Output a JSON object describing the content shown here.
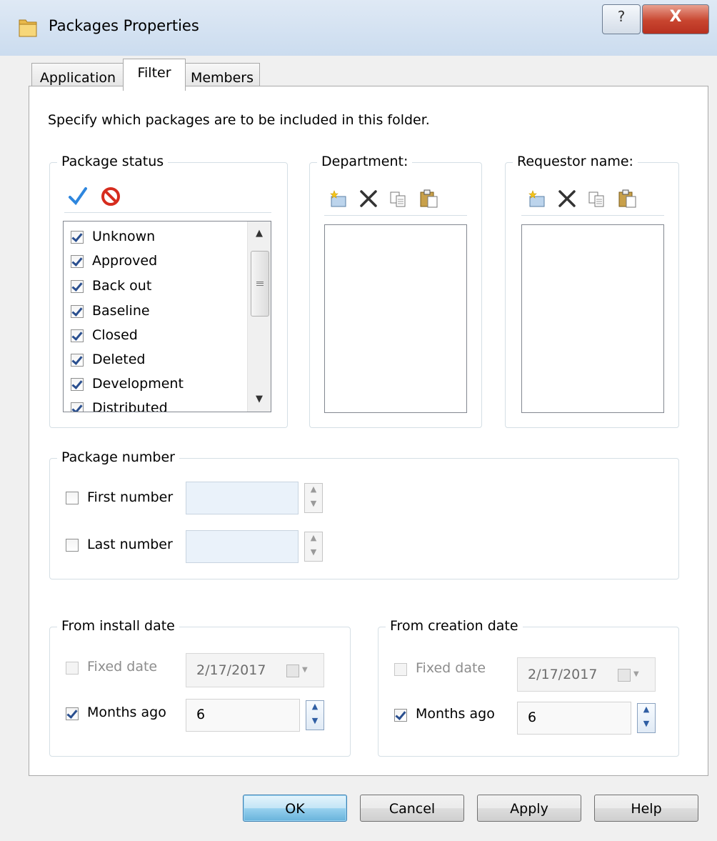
{
  "window": {
    "title": "Packages Properties",
    "help_glyph": "?",
    "close_glyph": "X"
  },
  "tabs": [
    {
      "label": "Application"
    },
    {
      "label": "Filter"
    },
    {
      "label": "Members"
    }
  ],
  "active_tab": "Filter",
  "instruction": "Specify which packages are to be included in this folder.",
  "package_status": {
    "title": "Package status",
    "toolbar_icons": [
      "check-all-icon",
      "uncheck-all-icon"
    ],
    "items": [
      {
        "label": "Unknown",
        "checked": true
      },
      {
        "label": "Approved",
        "checked": true
      },
      {
        "label": "Back out",
        "checked": true
      },
      {
        "label": "Baseline",
        "checked": true
      },
      {
        "label": "Closed",
        "checked": true
      },
      {
        "label": "Deleted",
        "checked": true
      },
      {
        "label": "Development",
        "checked": true
      },
      {
        "label": "Distributed",
        "checked": true
      }
    ]
  },
  "department": {
    "title": "Department:",
    "toolbar_icons": [
      "new-icon",
      "delete-icon",
      "copy-icon",
      "paste-icon"
    ]
  },
  "requestor": {
    "title": "Requestor name:",
    "toolbar_icons": [
      "new-icon",
      "delete-icon",
      "copy-icon",
      "paste-icon"
    ]
  },
  "package_number": {
    "title": "Package number",
    "first_label": "First number",
    "first_checked": false,
    "first_value": "",
    "last_label": "Last number",
    "last_checked": false,
    "last_value": ""
  },
  "install_date": {
    "title": "From install date",
    "fixed_label": "Fixed date",
    "fixed_checked": false,
    "fixed_value": "2/17/2017",
    "months_label": "Months ago",
    "months_checked": true,
    "months_value": "6"
  },
  "creation_date": {
    "title": "From creation date",
    "fixed_label": "Fixed date",
    "fixed_checked": false,
    "fixed_value": "2/17/2017",
    "months_label": "Months ago",
    "months_checked": true,
    "months_value": "6"
  },
  "buttons": {
    "ok": "OK",
    "cancel": "Cancel",
    "apply": "Apply",
    "help": "Help"
  }
}
